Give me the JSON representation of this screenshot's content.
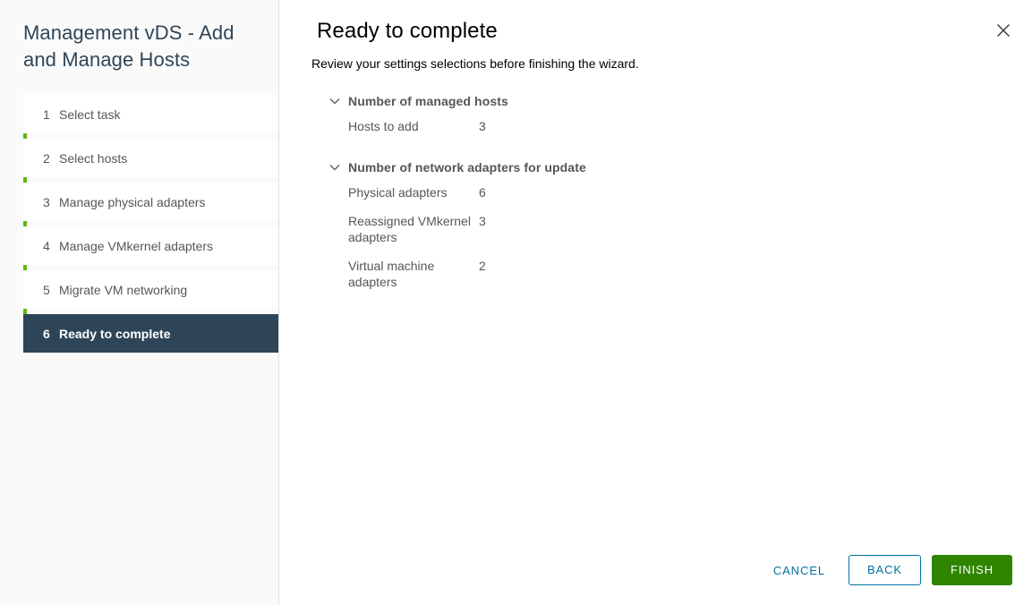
{
  "sidebar": {
    "title": "Management vDS - Add and Manage Hosts",
    "progress_completed_steps": 5,
    "accent_color": "#60b515",
    "active_color": "#2e4558",
    "steps": [
      {
        "num": "1",
        "label": "Select task",
        "active": false
      },
      {
        "num": "2",
        "label": "Select hosts",
        "active": false
      },
      {
        "num": "3",
        "label": "Manage physical adapters",
        "active": false
      },
      {
        "num": "4",
        "label": "Manage VMkernel adapters",
        "active": false
      },
      {
        "num": "5",
        "label": "Migrate VM networking",
        "active": false
      },
      {
        "num": "6",
        "label": "Ready to complete",
        "active": true
      }
    ]
  },
  "content": {
    "title": "Ready to complete",
    "subtitle": "Review your settings selections before finishing the wizard.",
    "close_icon": "close-icon",
    "sections": [
      {
        "title": "Number of managed hosts",
        "expanded": true,
        "rows": [
          {
            "label": "Hosts to add",
            "value": "3"
          }
        ]
      },
      {
        "title": "Number of network adapters for update",
        "expanded": true,
        "rows": [
          {
            "label": "Physical adapters",
            "value": "6"
          },
          {
            "label": "Reassigned VMkernel adapters",
            "value": "3"
          },
          {
            "label": "Virtual machine adapters",
            "value": "2"
          }
        ]
      }
    ]
  },
  "footer": {
    "cancel_label": "CANCEL",
    "back_label": "BACK",
    "finish_label": "FINISH",
    "link_color": "#0072a3",
    "finish_color": "#2f8400"
  }
}
